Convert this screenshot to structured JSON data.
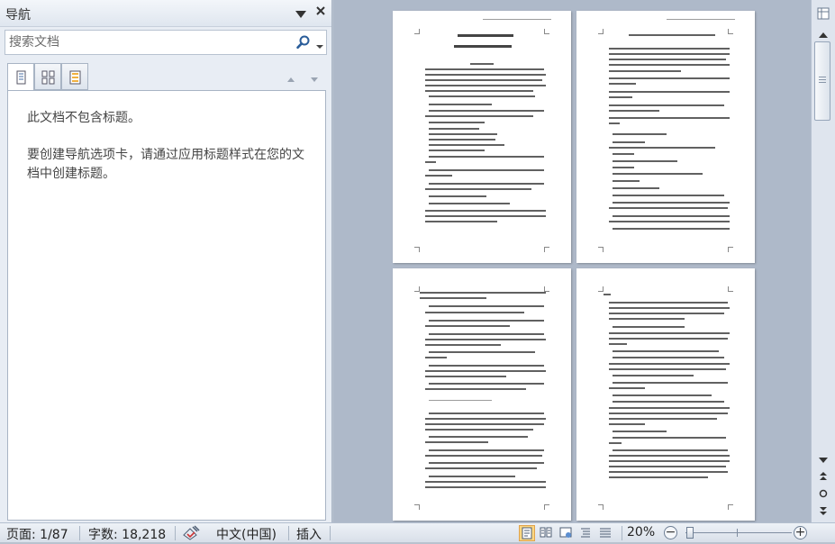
{
  "nav_pane": {
    "title": "导航",
    "search": {
      "placeholder": "搜索文档"
    },
    "tabs": [
      {
        "name": "headings-tab",
        "icon": "document-headings-icon",
        "active": true
      },
      {
        "name": "pages-tab",
        "icon": "page-thumbnails-icon",
        "active": false
      },
      {
        "name": "results-tab",
        "icon": "search-results-icon",
        "active": false
      }
    ],
    "message_line1": "此文档不包含标题。",
    "message_line2": "要创建导航选项卡，请通过应用标题样式在您的文档中创建标题。"
  },
  "status_bar": {
    "page": "页面: 1/87",
    "words": "字数: 18,218",
    "language": "中文(中国)",
    "insert_mode": "插入",
    "zoom": "20%",
    "zoom_minus": "−",
    "zoom_plus": "+"
  },
  "colors": {
    "workspace": "#aeb9c9",
    "pane": "#e8edf4",
    "active_view": "#fcd680"
  }
}
